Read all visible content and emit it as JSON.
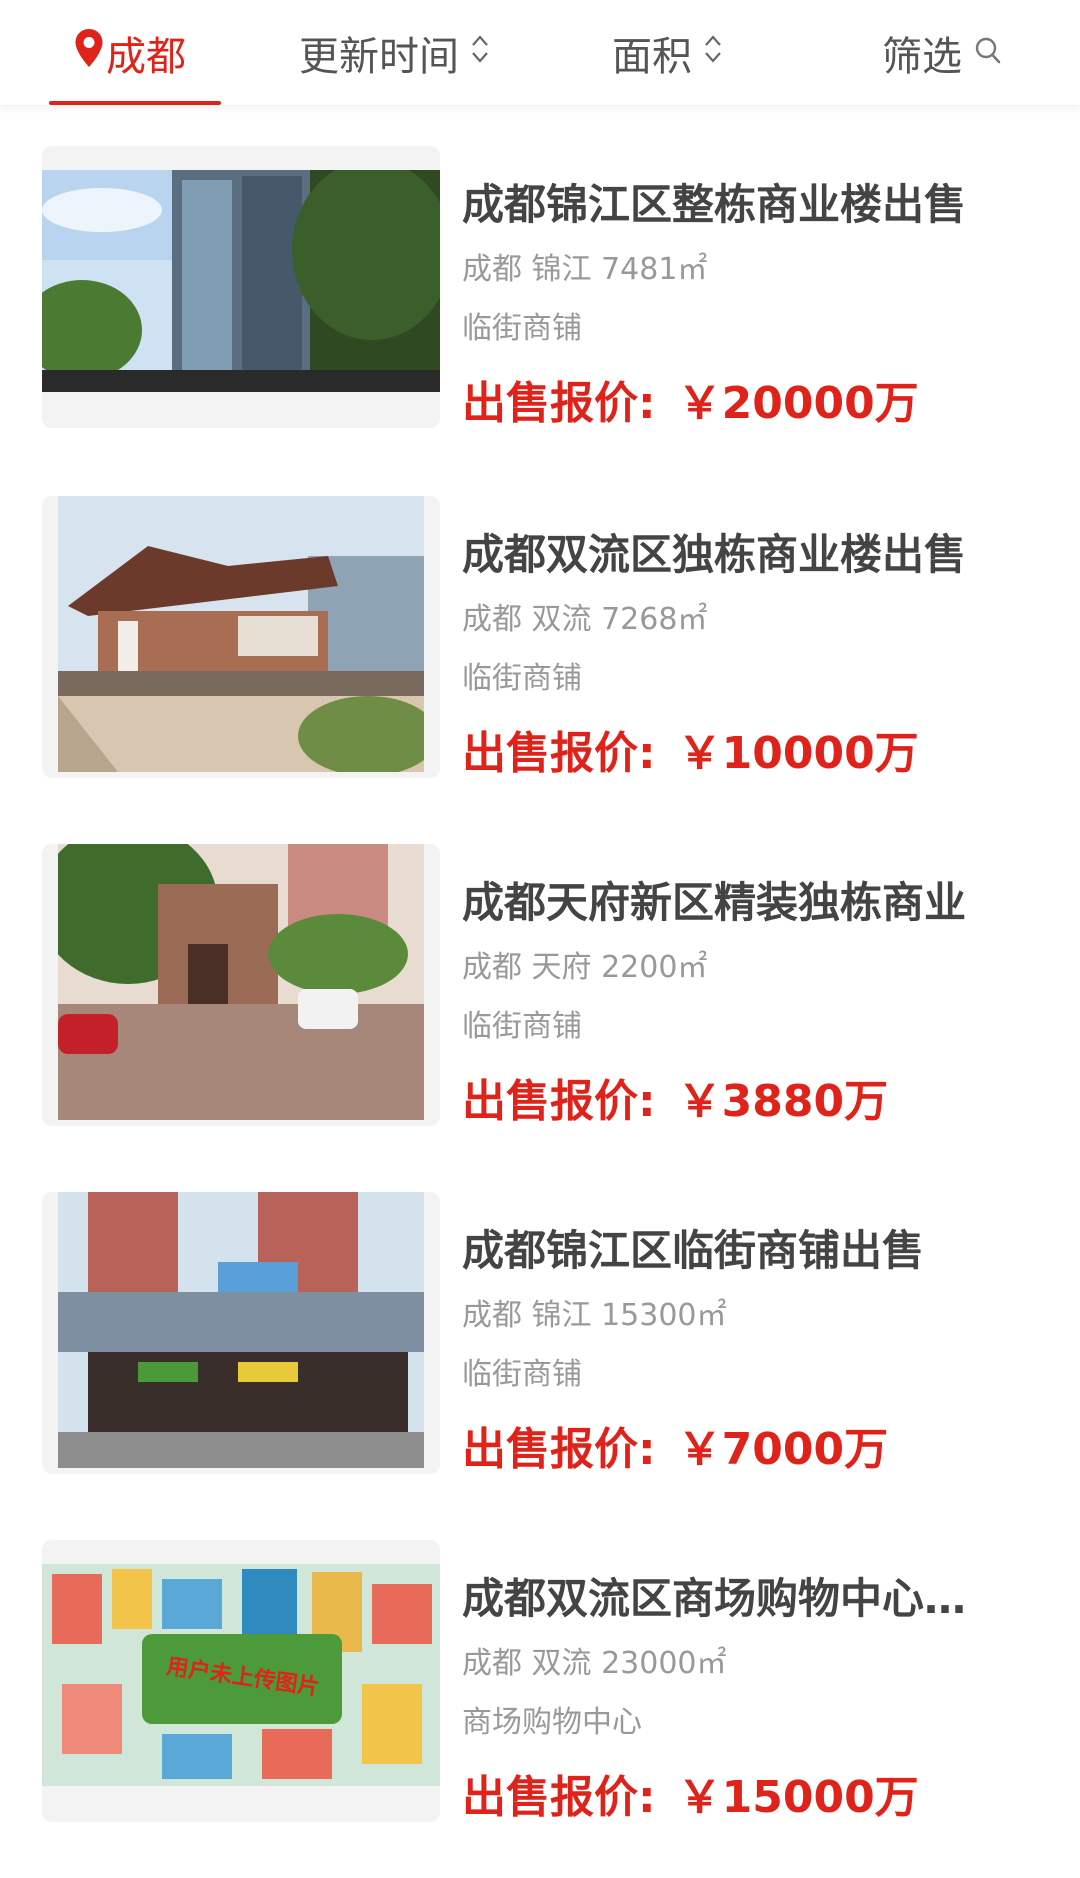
{
  "tabs": {
    "city": "成都",
    "time": "更新时间",
    "area": "面积",
    "filter": "筛选"
  },
  "colors": {
    "accent": "#e0231a",
    "text": "#444444",
    "muted": "#999999"
  },
  "listings": [
    {
      "title": "成都锦江区整栋商业楼出售",
      "meta": "成都 锦江 7481㎡",
      "type": "临街商铺",
      "price_label": "出售报价:",
      "price": "￥20000万",
      "image": "office-tower-photo"
    },
    {
      "title": "成都双流区独栋商业楼出售",
      "meta": "成都 双流 7268㎡",
      "type": "临街商铺",
      "price_label": "出售报价:",
      "price": "￥10000万",
      "image": "pavilion-building-photo"
    },
    {
      "title": "成都天府新区精装独栋商业",
      "meta": "成都 天府 2200㎡",
      "type": "临街商铺",
      "price_label": "出售报价:",
      "price": "￥3880万",
      "image": "villa-street-photo"
    },
    {
      "title": "成都锦江区临街商铺出售",
      "meta": "成都 锦江 15300㎡",
      "type": "临街商铺",
      "price_label": "出售报价:",
      "price": "￥7000万",
      "image": "storefront-highrise-photo"
    },
    {
      "title": "成都双流区商场购物中心出售",
      "meta": "成都 双流 23000㎡",
      "type": "商场购物中心",
      "price_label": "出售报价:",
      "price": "￥15000万",
      "image": "placeholder-town-illustration",
      "image_caption": "用户未上传图片"
    }
  ]
}
